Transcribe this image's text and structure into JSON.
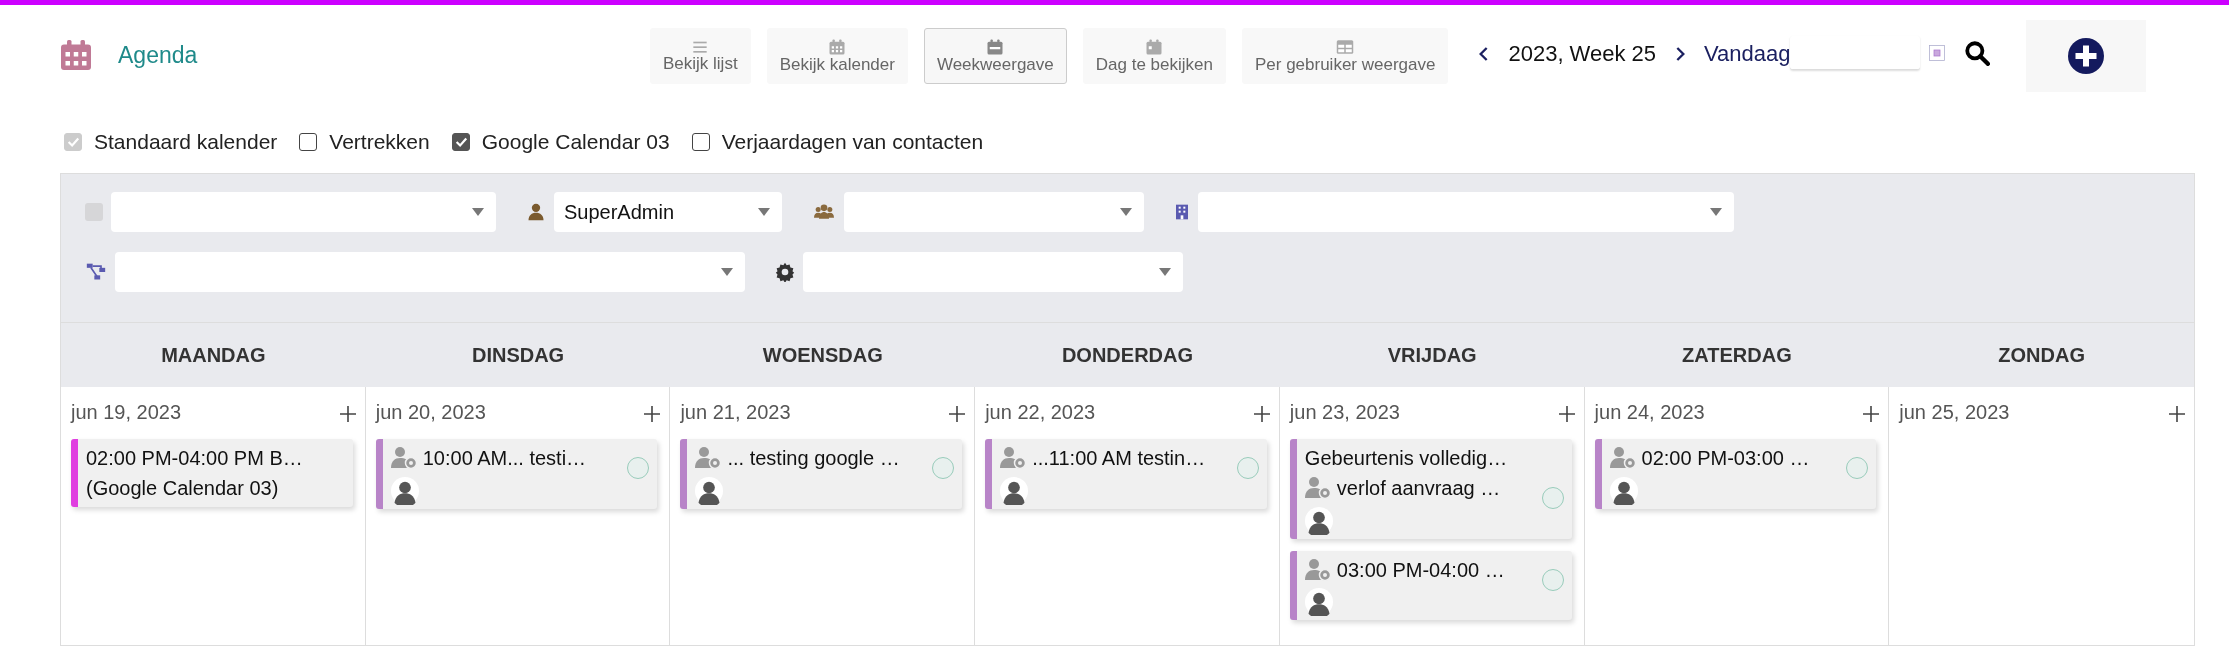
{
  "app": {
    "title": "Agenda"
  },
  "views": [
    {
      "label": "Bekijk lijst",
      "kind": "list",
      "selected": false
    },
    {
      "label": "Bekijk kalender",
      "kind": "calendar",
      "selected": false
    },
    {
      "label": "Weekweergave",
      "kind": "week",
      "selected": true
    },
    {
      "label": "Dag te bekijken",
      "kind": "day",
      "selected": false
    },
    {
      "label": "Per gebruiker weergave",
      "kind": "table",
      "selected": false
    }
  ],
  "navigation": {
    "period": "2023, Week 25",
    "today": "Vandaag"
  },
  "calendars": [
    {
      "label": "Standaard kalender",
      "checked": true,
      "disabled": true
    },
    {
      "label": "Vertrekken",
      "checked": false,
      "disabled": false
    },
    {
      "label": "Google Calendar 03",
      "checked": true,
      "disabled": false
    },
    {
      "label": "Verjaardagen van contacten",
      "checked": false,
      "disabled": false
    }
  ],
  "filters": [
    [
      {
        "kind": "checkbox",
        "checked": false
      },
      {
        "kind": "user",
        "value": "SuperAdmin"
      },
      {
        "kind": "group"
      },
      {
        "kind": "building"
      }
    ],
    [
      {
        "kind": "hierarchy"
      },
      {
        "kind": "settings"
      }
    ]
  ],
  "days": [
    {
      "name": "MAANDAG",
      "date": "jun 19, 2023",
      "events": [
        {
          "kind": "google",
          "color": "#e03ee0",
          "lines": [
            "02:00 PM-04:00 PM B…",
            "(Google Calendar 03)"
          ]
        }
      ]
    },
    {
      "name": "DINSDAG",
      "date": "jun 20, 2023",
      "events": [
        {
          "kind": "user",
          "color": "#b884c8",
          "text": "10:00 AM... testi…"
        }
      ]
    },
    {
      "name": "WOENSDAG",
      "date": "jun 21, 2023",
      "events": [
        {
          "kind": "user",
          "color": "#b884c8",
          "text": "... testing google …"
        }
      ]
    },
    {
      "name": "DONDERDAG",
      "date": "jun 22, 2023",
      "events": [
        {
          "kind": "user",
          "color": "#b884c8",
          "text": "...11:00 AM testin…"
        }
      ]
    },
    {
      "name": "VRIJDAG",
      "date": "jun 23, 2023",
      "events": [
        {
          "kind": "user",
          "color": "#b884c8",
          "title": "Gebeurtenis volledig…",
          "text": "verlof aanvraag …"
        },
        {
          "kind": "user",
          "color": "#b884c8",
          "text": "03:00 PM-04:00 …"
        }
      ]
    },
    {
      "name": "ZATERDAG",
      "date": "jun 24, 2023",
      "events": [
        {
          "kind": "user",
          "color": "#b884c8",
          "text": "02:00 PM-03:00 …"
        }
      ]
    },
    {
      "name": "ZONDAG",
      "date": "jun 25, 2023"
    }
  ]
}
